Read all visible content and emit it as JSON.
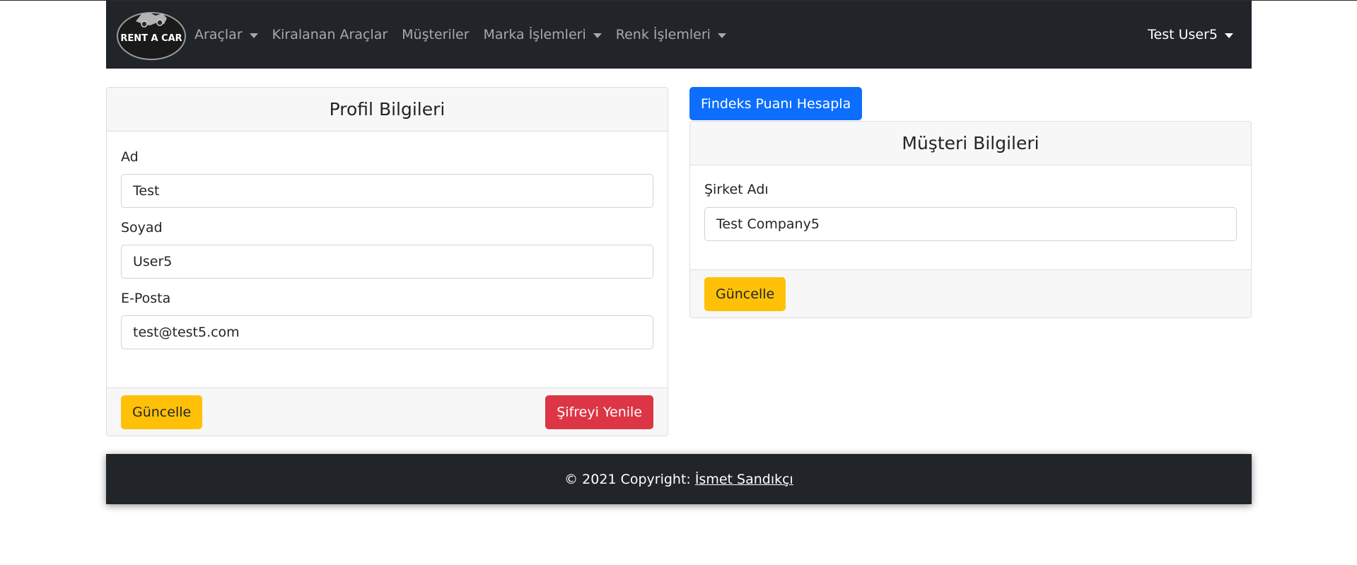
{
  "navbar": {
    "logo_text": "RENT A CAR",
    "items": [
      {
        "label": "Araçlar",
        "dropdown": true
      },
      {
        "label": "Kiralanan Araçlar",
        "dropdown": false
      },
      {
        "label": "Müşteriler",
        "dropdown": false
      },
      {
        "label": "Marka İşlemleri",
        "dropdown": true
      },
      {
        "label": "Renk İşlemleri",
        "dropdown": true
      }
    ],
    "user_label": "Test User5"
  },
  "profile_card": {
    "title": "Profil Bilgileri",
    "fields": [
      {
        "label": "Ad",
        "value": "Test"
      },
      {
        "label": "Soyad",
        "value": "User5"
      },
      {
        "label": "E-Posta",
        "value": "test@test5.com"
      }
    ],
    "update_label": "Güncelle",
    "reset_password_label": "Şifreyi Yenile"
  },
  "findeks_button_label": "Findeks Puanı Hesapla",
  "customer_card": {
    "title": "Müşteri Bilgileri",
    "company_label": "Şirket Adı",
    "company_value": "Test Company5",
    "update_label": "Güncelle"
  },
  "footer": {
    "copyright_text": "© 2021 Copyright:",
    "author_link": "İsmet Sandıkçı"
  },
  "colors": {
    "navbar_bg": "#212529",
    "primary": "#0d6efd",
    "warning": "#ffc107",
    "danger": "#dc3545"
  }
}
